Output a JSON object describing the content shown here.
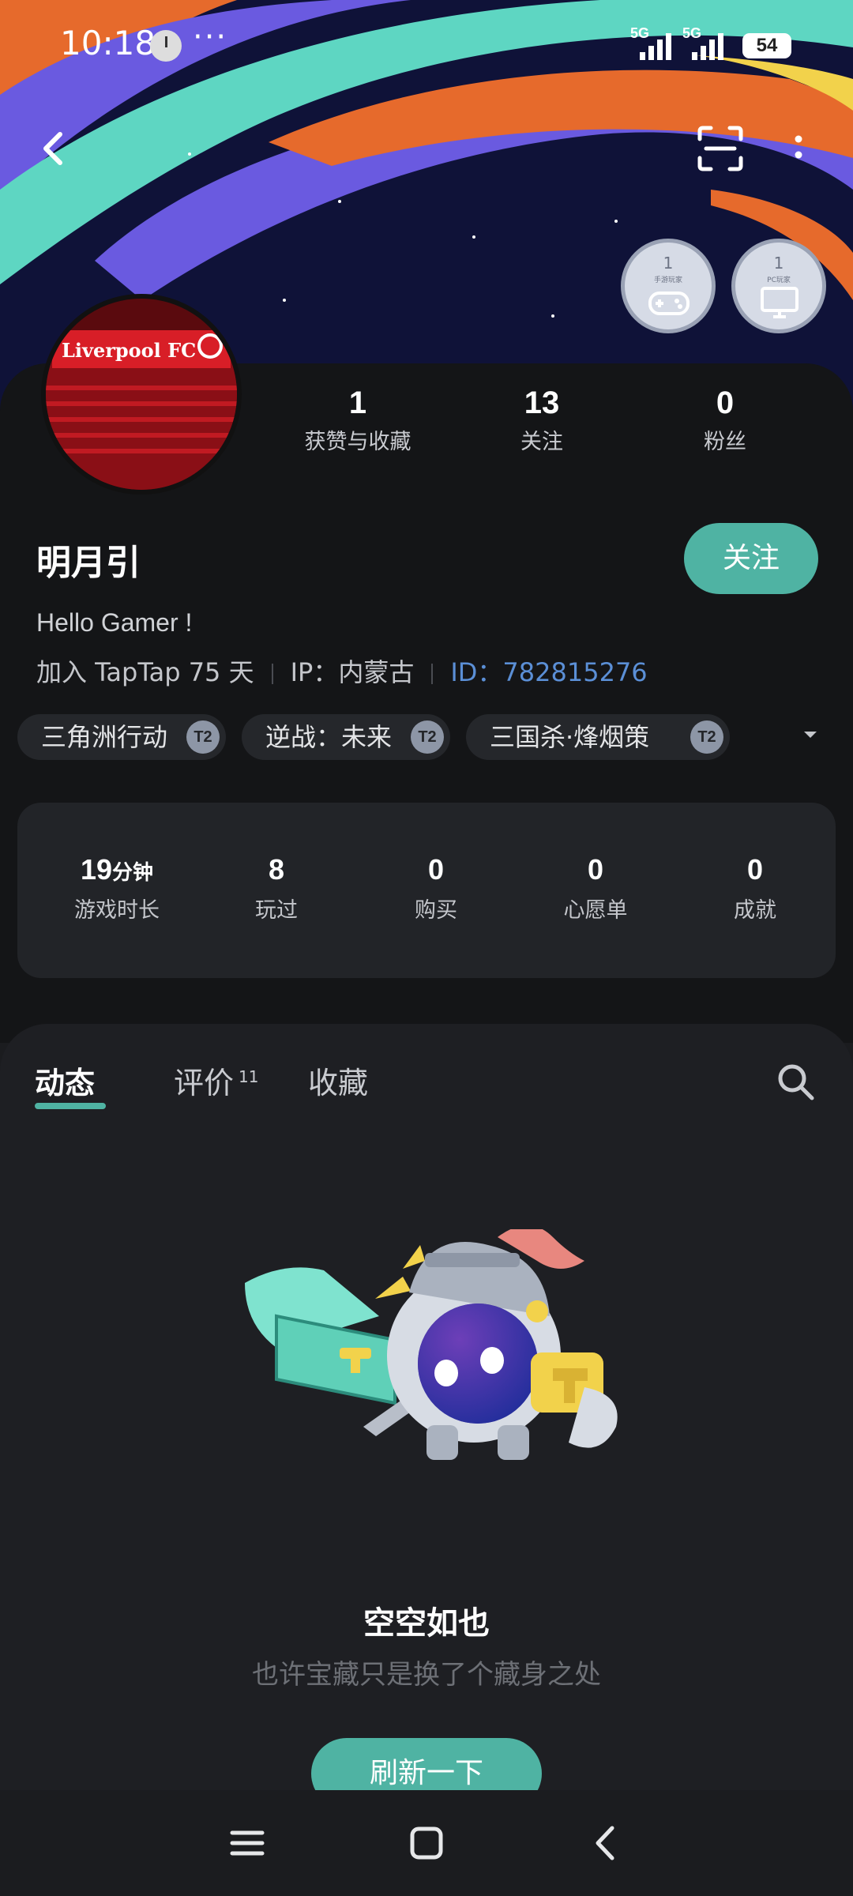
{
  "status_bar": {
    "time": "10:18",
    "dots": "···",
    "signal1": "5G",
    "signal2": "5G",
    "battery": "54"
  },
  "profile": {
    "username": "明月引",
    "follow_label": "关注",
    "bio": "Hello Gamer !",
    "joined": "加入 TapTap 75 天",
    "ip": "IP：内蒙古",
    "id": "ID：782815276",
    "avatar_text": "Liverpool FC"
  },
  "badges": [
    {
      "count": "1",
      "caption": "手游玩家"
    },
    {
      "count": "1",
      "caption": "PC玩家"
    }
  ],
  "stats": [
    {
      "value": "1",
      "label": "获赞与收藏"
    },
    {
      "value": "13",
      "label": "关注"
    },
    {
      "value": "0",
      "label": "粉丝"
    }
  ],
  "tags": [
    {
      "name": "三角洲行动",
      "badge": "T2"
    },
    {
      "name": "逆战：未来",
      "badge": "T2"
    },
    {
      "name": "三国杀·烽烟策",
      "badge": "T2"
    }
  ],
  "game_stats": [
    {
      "value": "19",
      "unit": "分钟",
      "label": "游戏时长"
    },
    {
      "value": "8",
      "unit": "",
      "label": "玩过"
    },
    {
      "value": "0",
      "unit": "",
      "label": "购买"
    },
    {
      "value": "0",
      "unit": "",
      "label": "心愿单"
    },
    {
      "value": "0",
      "unit": "",
      "label": "成就"
    }
  ],
  "tabs": [
    {
      "label": "动态",
      "count": ""
    },
    {
      "label": "评价",
      "count": "11"
    },
    {
      "label": "收藏",
      "count": ""
    }
  ],
  "empty_state": {
    "title": "空空如也",
    "subtitle": "也许宝藏只是换了个藏身之处",
    "button": "刷新一下"
  },
  "colors": {
    "accent": "#4fb3a3",
    "id_blue": "#5b8fd6",
    "background": "#1b1c1f"
  }
}
